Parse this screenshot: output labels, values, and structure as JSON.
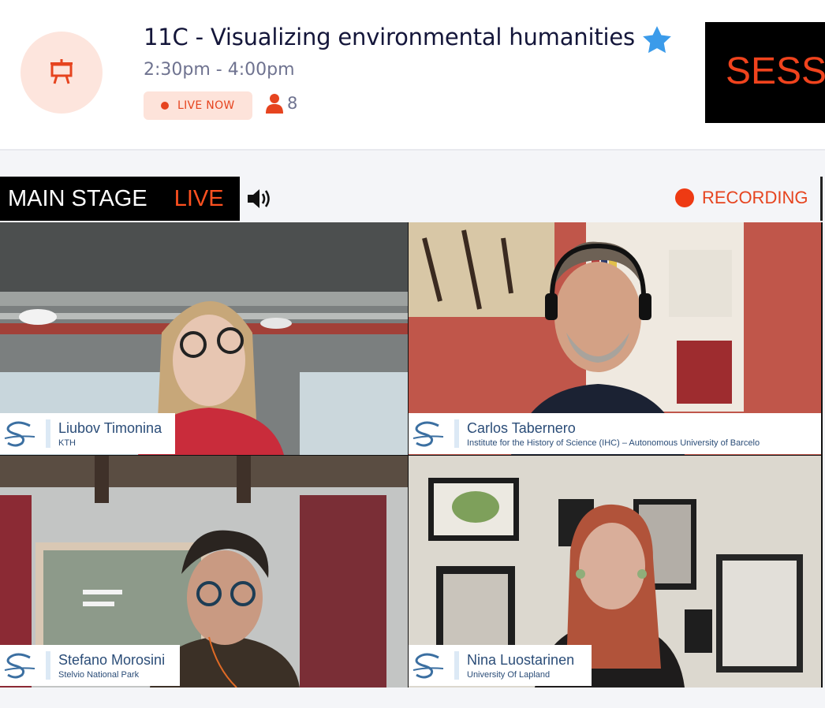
{
  "session": {
    "title": "11C - Visualizing environmental humanities",
    "time": "2:30pm - 4:00pm",
    "live_label": "LIVE NOW",
    "attendee_count": "8",
    "icon": "presentation-board-icon",
    "favorite_icon": "star-icon"
  },
  "promo": {
    "text": "SESSI"
  },
  "stage": {
    "label": "MAIN STAGE",
    "live": "LIVE",
    "audio_icon": "speaker-icon",
    "recording_label": "RECORDING"
  },
  "participants": [
    {
      "name": "Liubov Timonina",
      "affiliation": "KTH"
    },
    {
      "name": "Carlos Tabernero",
      "affiliation": "Institute for the History of Science (IHC) – Autonomous University of Barcelo"
    },
    {
      "name": "Stefano Morosini",
      "affiliation": "Stelvio National Park"
    },
    {
      "name": "Nina Luostarinen",
      "affiliation": "University Of Lapland"
    }
  ],
  "colors": {
    "accent": "#e6441f",
    "title": "#14163a",
    "muted": "#6f7390",
    "star": "#3b9bea",
    "card_text": "#2b4d78"
  }
}
